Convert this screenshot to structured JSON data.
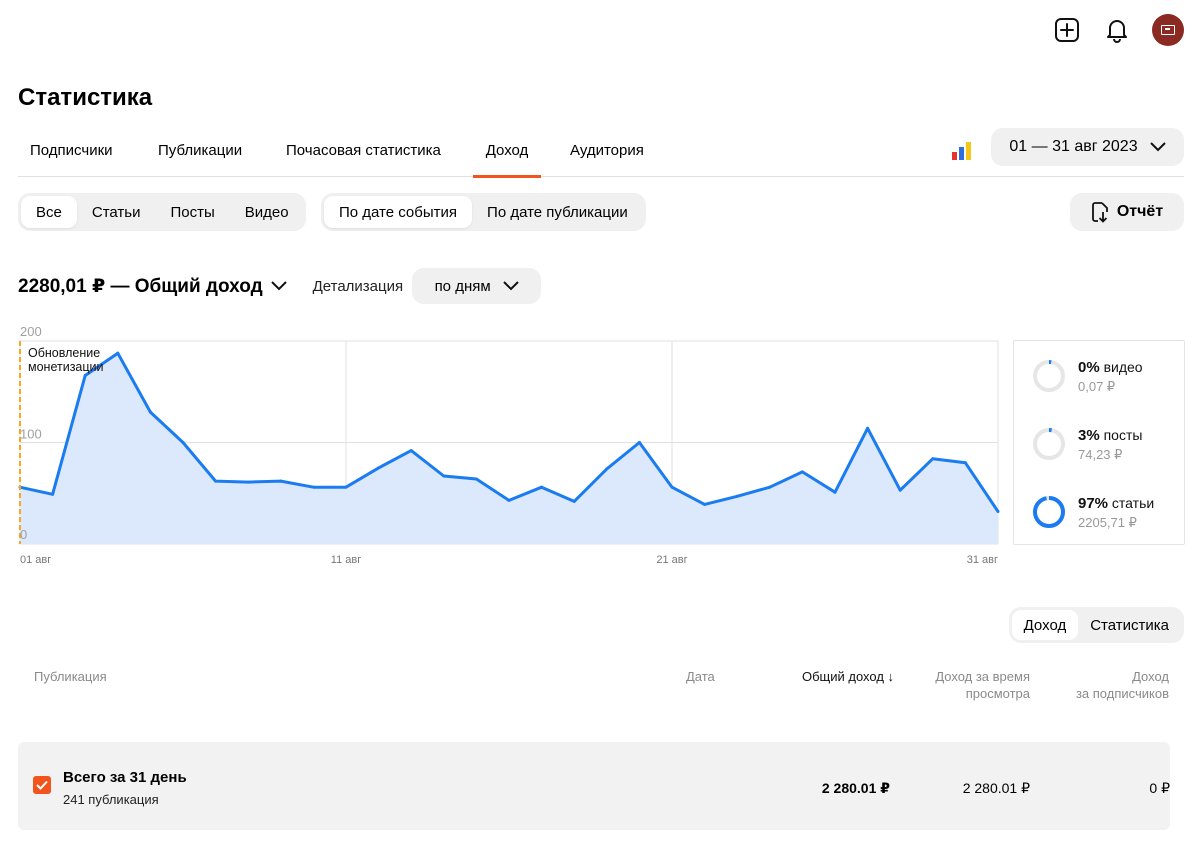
{
  "page": {
    "title": "Статистика"
  },
  "tabs": [
    {
      "label": "Подписчики",
      "active": false
    },
    {
      "label": "Публикации",
      "active": false
    },
    {
      "label": "Почасовая статистика",
      "active": false
    },
    {
      "label": "Доход",
      "active": true
    },
    {
      "label": "Аудитория",
      "active": false
    }
  ],
  "date_range": "01 — 31 авг 2023",
  "content_filter": [
    "Все",
    "Статьи",
    "Посты",
    "Видео"
  ],
  "date_filter": [
    "По дате события",
    "По дате публикации"
  ],
  "report_button": "Отчёт",
  "summary": {
    "total_label": "2280,01 ₽ — Общий доход",
    "detail_label": "Детализация",
    "detail_value": "по дням"
  },
  "chart_data": {
    "type": "area",
    "title": "",
    "xlabel": "",
    "ylabel": "",
    "ylim": [
      0,
      200
    ],
    "yticks": [
      "0",
      "100",
      "200"
    ],
    "xticks": [
      "01 авг",
      "11 авг",
      "21 авг",
      "31 авг"
    ],
    "x": [
      "01 авг",
      "02 авг",
      "03 авг",
      "04 авг",
      "05 авг",
      "06 авг",
      "07 авг",
      "08 авг",
      "09 авг",
      "10 авг",
      "11 авг",
      "12 авг",
      "13 авг",
      "14 авг",
      "15 авг",
      "16 авг",
      "17 авг",
      "18 авг",
      "19 авг",
      "20 авг",
      "21 авг",
      "22 авг",
      "23 авг",
      "24 авг",
      "25 авг",
      "26 авг",
      "27 авг",
      "28 авг",
      "29 авг",
      "30 авг",
      "31 авг"
    ],
    "series": [
      {
        "values": [
          56,
          49,
          166,
          188,
          130,
          100,
          62,
          61,
          62,
          56,
          56,
          75,
          92,
          67,
          64,
          43,
          56,
          42,
          74,
          100,
          56,
          39,
          47,
          56,
          71,
          51,
          114,
          53,
          84,
          80,
          32
        ]
      }
    ],
    "annotation": "Обновление монетизации",
    "annotation_x": "01 авг",
    "color": "#1a7cf0",
    "fill": "#dce8fb",
    "marker_color": "#f5a623",
    "grid": true
  },
  "breakdown": [
    {
      "percent": "0%",
      "label": "видео",
      "value": "0,07 ₽",
      "ratio": 0.0003
    },
    {
      "percent": "3%",
      "label": "посты",
      "value": "74,23 ₽",
      "ratio": 0.03
    },
    {
      "percent": "97%",
      "label": "статьи",
      "value": "2205,71 ₽",
      "ratio": 0.97
    }
  ],
  "table_toggle": [
    "Доход",
    "Статистика"
  ],
  "table": {
    "headers": {
      "publication": "Публикация",
      "date": "Дата",
      "total": "Общий доход ↓",
      "view_line1": "Доход за время",
      "view_line2": "просмотра",
      "subs_line1": "Доход",
      "subs_line2": "за подписчиков"
    },
    "total_row": {
      "title": "Всего за 31 день",
      "subtitle": "241 публикация",
      "total": "2 280.01 ₽",
      "view": "2 280.01 ₽",
      "subs": "0 ₽"
    }
  },
  "colors": {
    "accent": "#f2541d",
    "chart_line": "#1a7cf0",
    "brand_bars": [
      "#e8332a",
      "#2e6fe0",
      "#f5c518"
    ]
  }
}
